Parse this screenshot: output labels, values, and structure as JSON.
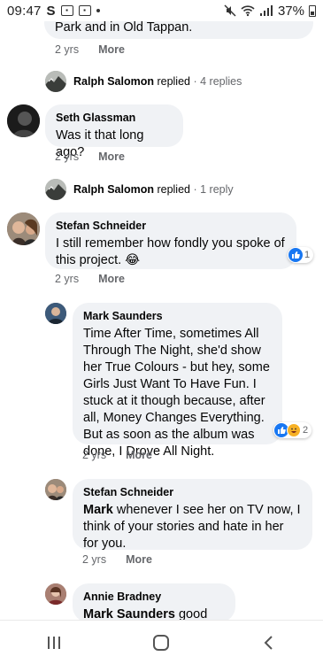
{
  "status": {
    "time": "09:47",
    "battery": "37%"
  },
  "top_comment": {
    "text": "Park and in Old Tappan.",
    "age": "2 yrs",
    "more": "More"
  },
  "replied_1": {
    "name": "Ralph Salomon",
    "verb": "replied",
    "count": "· 4 replies"
  },
  "seth": {
    "name": "Seth Glassman",
    "text": "Was it that long ago?",
    "age": "2 yrs",
    "more": "More"
  },
  "replied_2": {
    "name": "Ralph Salomon",
    "verb": "replied",
    "count": "· 1 reply"
  },
  "stefan_1": {
    "name": "Stefan Schneider",
    "text": "I still remember how fondly you spoke of this project. 😂",
    "age": "2 yrs",
    "more": "More",
    "reactions": "1"
  },
  "mark": {
    "name": "Mark Saunders",
    "text": "Time After Time, sometimes All Through The Night, she'd show her True Colours - but hey, some Girls Just Want To Have Fun. I stuck at it though because, after all, Money Changes Everything. But as soon as the album was done, I Drove All Night.",
    "age": "2 yrs",
    "more": "More",
    "reactions": "2"
  },
  "stefan_2": {
    "name": "Stefan Schneider",
    "mention": "Mark",
    "text": " whenever I see her on TV now, I think of your stories and hate in her for you.",
    "age": "2 yrs",
    "more": "More"
  },
  "annie": {
    "name": "Annie Bradney",
    "mention": "Mark Saunders",
    "text": " good lord"
  }
}
